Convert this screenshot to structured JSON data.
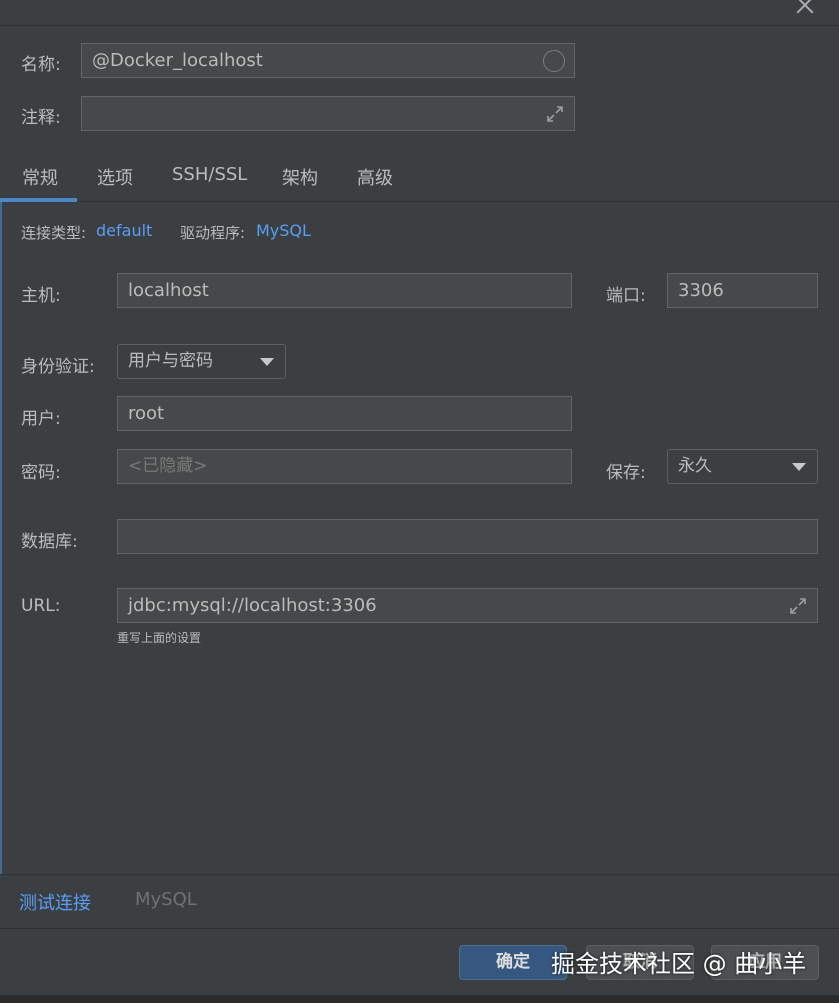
{
  "header": {
    "close_icon": "close-icon"
  },
  "form_top": {
    "name_label": "名称:",
    "name_value": "@Docker_localhost",
    "comment_label": "注释:",
    "comment_value": ""
  },
  "tabs": [
    {
      "label": "常规",
      "active": true
    },
    {
      "label": "选项"
    },
    {
      "label": "SSH/SSL"
    },
    {
      "label": "架构"
    },
    {
      "label": "高级"
    }
  ],
  "info": {
    "conn_type_label": "连接类型:",
    "conn_type_value": "default",
    "driver_label": "驱动程序:",
    "driver_value": "MySQL"
  },
  "general": {
    "host_label": "主机:",
    "host_value": "localhost",
    "port_label": "端口:",
    "port_value": "3306",
    "auth_label": "身份验证:",
    "auth_value": "用户与密码",
    "user_label": "用户:",
    "user_value": "root",
    "password_label": "密码:",
    "password_placeholder": "<已隐藏>",
    "save_label": "保存:",
    "save_value": "永久",
    "database_label": "数据库:",
    "database_value": "",
    "url_label": "URL:",
    "url_value": "jdbc:mysql://localhost:3306",
    "url_hint": "重写上面的设置"
  },
  "bottom": {
    "test_connection": "测试连接",
    "driver_name": "MySQL"
  },
  "footer": {
    "ok_label": "确定",
    "cancel_label": "取消",
    "apply_label": "应用"
  },
  "watermark": "掘金技术社区 @ 曲小羊",
  "colors": {
    "accent": "#4a88c7",
    "link": "#589df6",
    "background": "#3c3f41",
    "field": "#45494a"
  }
}
